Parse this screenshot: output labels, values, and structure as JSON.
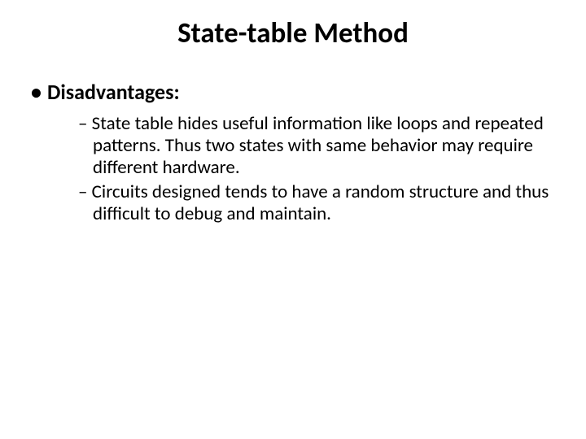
{
  "title": "State-table Method",
  "bullet_glyph": "•",
  "dash_glyph": "–",
  "heading": "Disadvantages:",
  "points": [
    "State table hides useful information like loops and repeated patterns. Thus two states with same behavior may require different hardware.",
    "Circuits designed tends to have a random structure and thus difficult to debug and maintain."
  ]
}
